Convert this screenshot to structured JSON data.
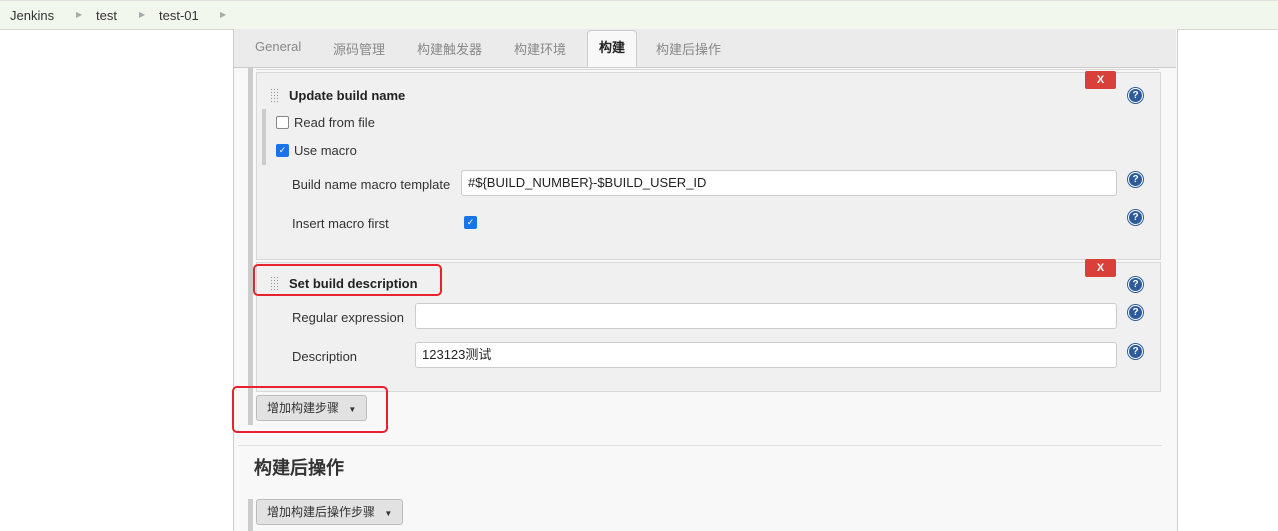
{
  "breadcrumbs": [
    "Jenkins",
    "test",
    "test-01"
  ],
  "tabs": [
    "General",
    "源码管理",
    "构建触发器",
    "构建环境",
    "构建",
    "构建后操作"
  ],
  "active_tab": "构建",
  "update_build_name": {
    "title": "Update build name",
    "read_from_file": "Read from file",
    "read_from_file_checked": false,
    "use_macro": "Use macro",
    "use_macro_checked": true,
    "template_label": "Build name macro template",
    "template_value": "#${BUILD_NUMBER}-$BUILD_USER_ID",
    "insert_first_label": "Insert macro first",
    "insert_first_checked": true,
    "delete": "X"
  },
  "set_build_description": {
    "title": "Set build description",
    "regex_label": "Regular expression",
    "regex_value": "",
    "description_label": "Description",
    "description_value": "123123测试",
    "delete": "X"
  },
  "add_build_step": "增加构建步骤",
  "post_build_heading": "构建后操作",
  "add_post_build_step": "增加构建后操作步骤",
  "help": "?",
  "accent": "#d9403a"
}
